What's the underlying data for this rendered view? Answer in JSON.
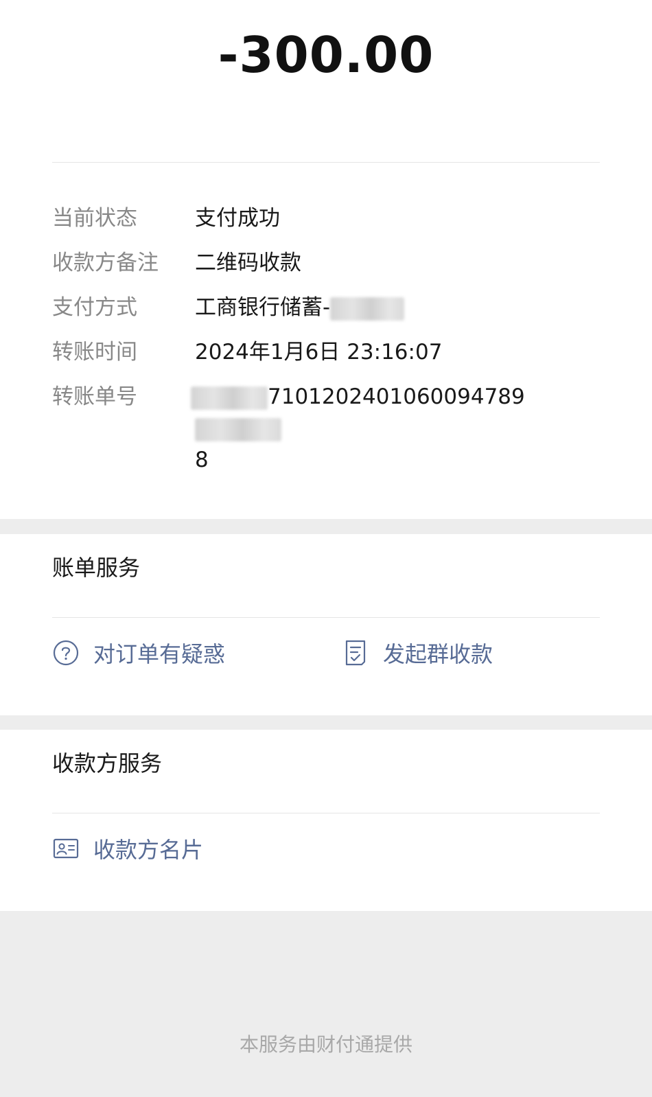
{
  "amount": "-300.00",
  "details": [
    {
      "label": "当前状态",
      "value": "支付成功"
    },
    {
      "label": "收款方备注",
      "value": "二维码收款"
    },
    {
      "label": "支付方式",
      "value": "工商银行储蓄-"
    },
    {
      "label": "转账时间",
      "value": "2024年1月6日 23:16:07"
    },
    {
      "label": "转账单号",
      "value_visible_middle": "71012024010600947​89",
      "value_tail": "8"
    }
  ],
  "bill_service": {
    "title": "账单服务",
    "actions": [
      {
        "label": "对订单有疑惑",
        "icon": "question-circle-icon"
      },
      {
        "label": "发起群收款",
        "icon": "receipt-check-icon"
      }
    ]
  },
  "payee_service": {
    "title": "收款方服务",
    "actions": [
      {
        "label": "收款方名片",
        "icon": "contact-card-icon"
      }
    ]
  },
  "footer": "本服务由财付通提供",
  "colors": {
    "link": "#576b95",
    "label": "#888888",
    "background": "#ededed"
  }
}
